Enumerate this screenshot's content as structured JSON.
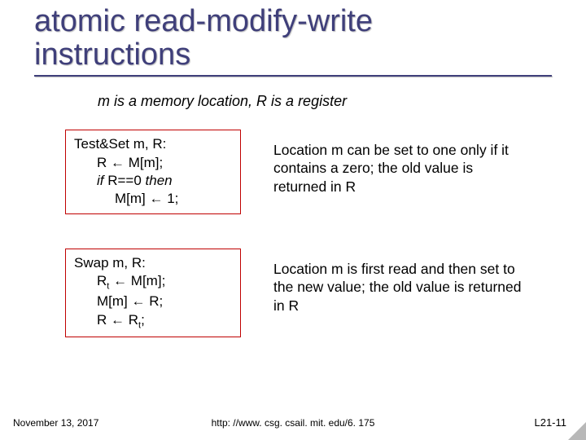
{
  "title_line1": "atomic read-modify-write",
  "title_line2": "instructions",
  "subtitle": "m is a memory location, R is a register",
  "box1": {
    "l1": "Test&Set m, R:",
    "l2a": "R ",
    "l2b": " M[m];",
    "l3a": "if",
    "l3b": "  R==0 ",
    "l3c": "then",
    "l4a": "M[m] ",
    "l4b": " 1;"
  },
  "desc1": "Location m can be set to one only if it contains a zero; the old value is returned in R",
  "box2": {
    "l1": "Swap m, R:",
    "l2a": "R",
    "l2sub": "t",
    "l2b": " ",
    "l2c": " M[m];",
    "l3a": "M[m] ",
    "l3b": " R;",
    "l4a": "R ",
    "l4b": " R",
    "l4sub": "t",
    "l4c": ";"
  },
  "desc2": "Location m is first read and then set to the new value; the old value is returned in R",
  "arrow": "←",
  "footer": {
    "date": "November 13, 2017",
    "url": "http: //www. csg. csail. mit. edu/6. 175",
    "page": "L21-11"
  }
}
